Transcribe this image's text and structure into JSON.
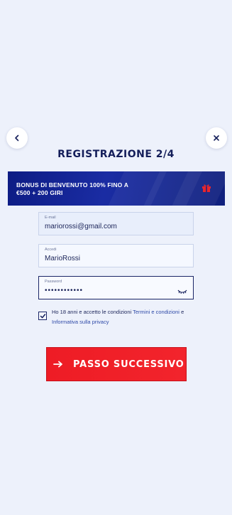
{
  "header": {
    "title": "REGISTRAZIONE 2/4"
  },
  "banner": {
    "line1": "BONUS DI BENVENUTO 100% FINO A",
    "line2": "€500 + 200 GIRI",
    "icon": "gift-icon"
  },
  "form": {
    "email": {
      "label": "E-mail",
      "value": "mariorossi@gmail.com"
    },
    "username": {
      "label": "Accedi",
      "value": "MarioRossi"
    },
    "password": {
      "label": "Password",
      "value": "••••••••••••"
    }
  },
  "consent": {
    "checked": true,
    "text_before": "Ho 18 anni e accetto le condizioni ",
    "terms_link": "Termini e condizioni",
    "text_middle": " e ",
    "privacy_link": "Informativa sulla privacy"
  },
  "cta": {
    "label": "PASSO SUCCESSIVO"
  },
  "colors": {
    "background": "#edf1fb",
    "navy": "#141e5a",
    "banner": "#0d1c84",
    "cta_red": "#ee1c25",
    "link_blue": "#2f4aa8"
  }
}
